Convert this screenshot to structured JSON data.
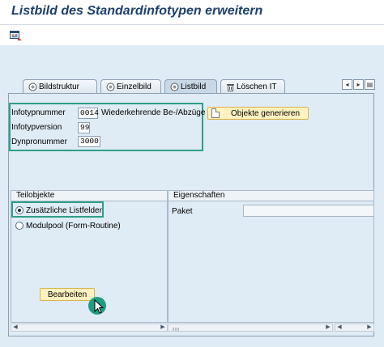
{
  "window": {
    "title": "Listbild des Standardinfotypen erweitern"
  },
  "toolbar": {
    "icon": "execute-icon"
  },
  "tabs": [
    {
      "label": "Bildstruktur",
      "icon": "radio-tab-icon",
      "active": false
    },
    {
      "label": "Einzelbild",
      "icon": "radio-tab-icon",
      "active": false
    },
    {
      "label": "Listbild",
      "icon": "radio-tab-icon",
      "active": true
    },
    {
      "label": "Löschen IT",
      "icon": "trash-icon",
      "active": false
    }
  ],
  "fields": {
    "infotyp_label": "Infotypnummer",
    "infotyp_value": "0014",
    "infotyp_desc": "Wiederkehrende Be-/Abzüge",
    "version_label": "Infotypversion",
    "version_value": "99",
    "dynpro_label": "Dynpronummer",
    "dynpro_value": "3000"
  },
  "buttons": {
    "generate_label": "Objekte generieren",
    "edit_label": "Bearbeiten"
  },
  "teilobjekte": {
    "header": "Teilobjekte",
    "options": [
      {
        "label": "Zusätzliche Listfelder",
        "selected": true
      },
      {
        "label": "Modulpool (Form-Routine)",
        "selected": false
      }
    ]
  },
  "eigenschaften": {
    "header": "Eigenschaften",
    "paket_label": "Paket",
    "paket_value": ""
  },
  "colors": {
    "highlight": "#2e9f86",
    "button_bg": "#fff2c0",
    "panel_bg": "#dfebf5",
    "title": "#1d3f6e"
  }
}
